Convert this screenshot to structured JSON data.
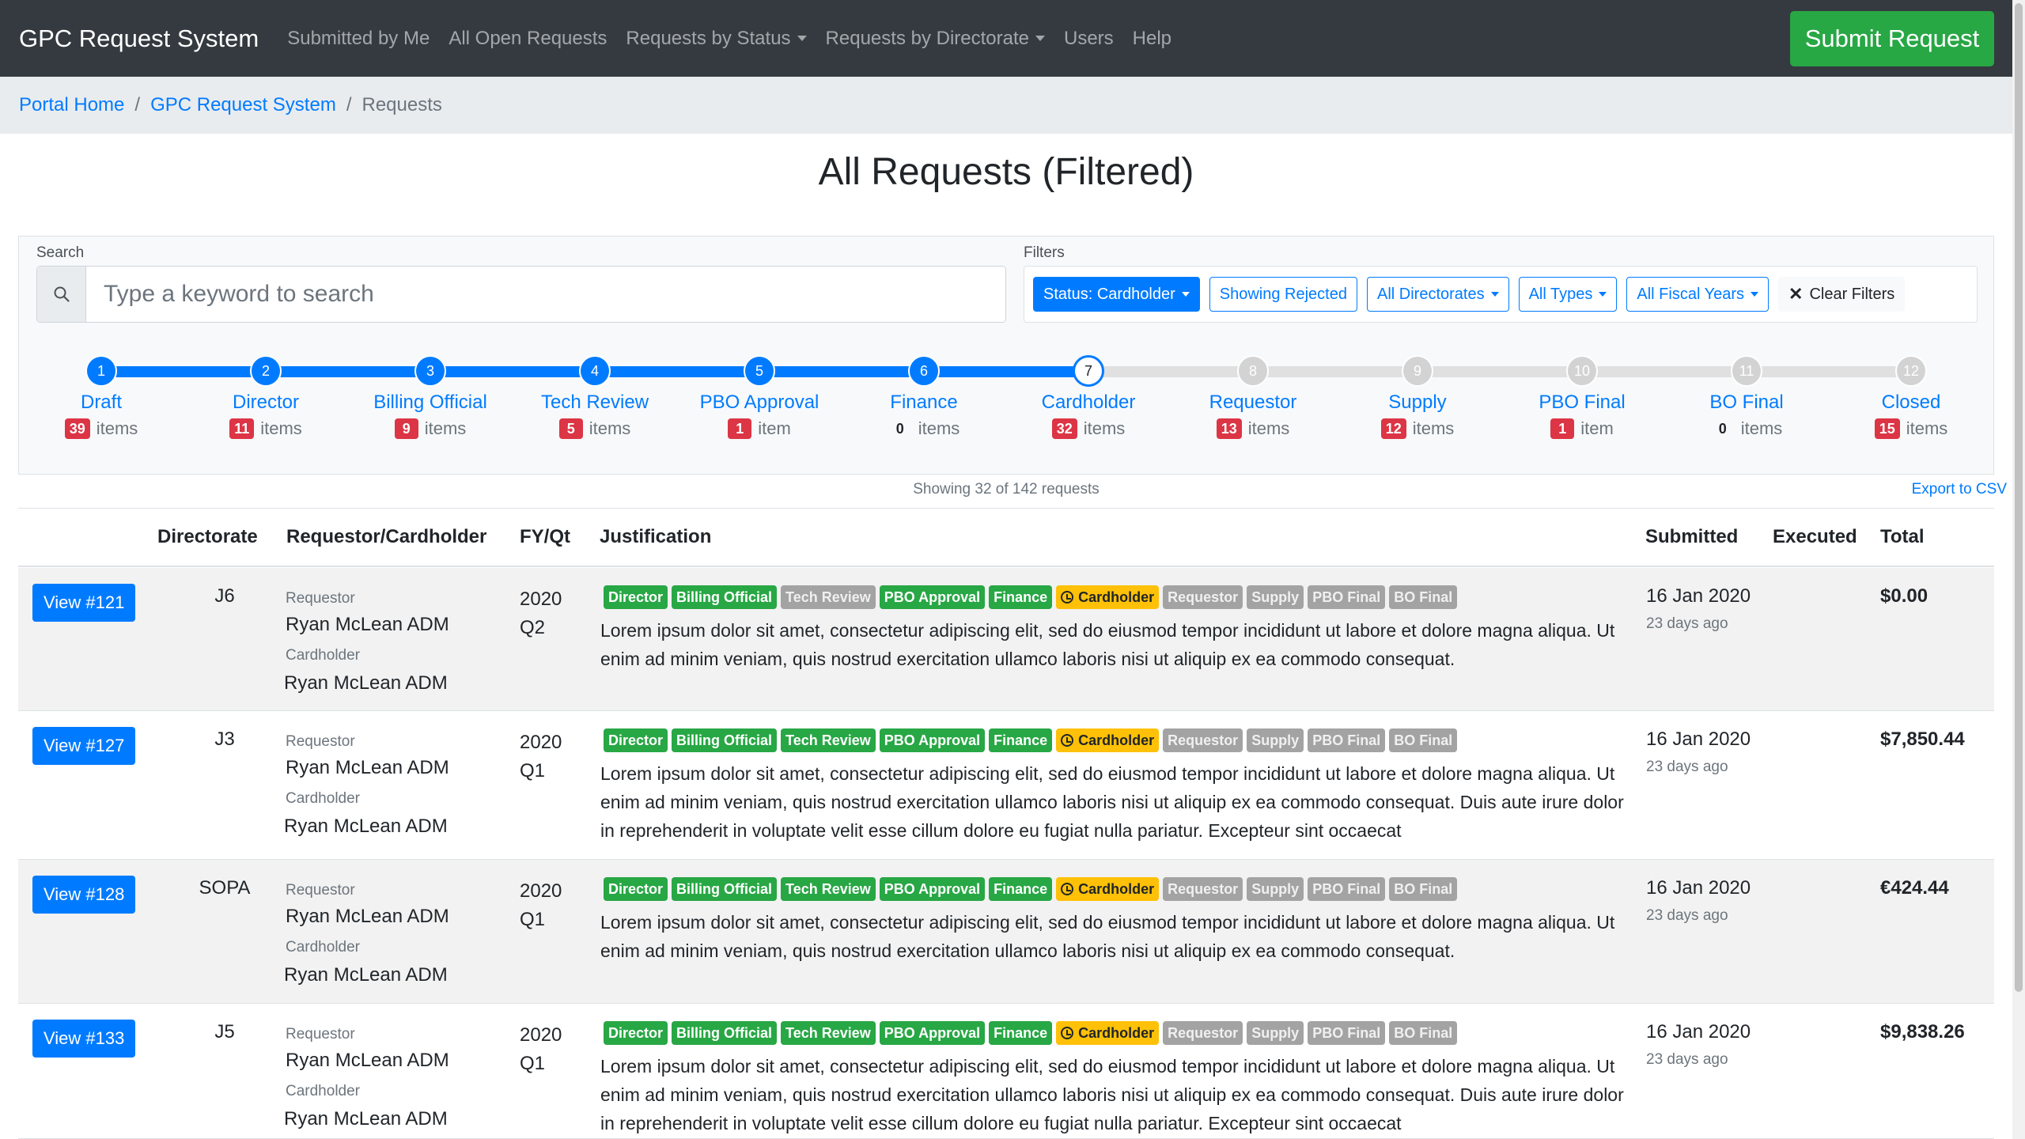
{
  "nav": {
    "brand": "GPC Request System",
    "links": [
      {
        "label": "Submitted by Me"
      },
      {
        "label": "All Open Requests"
      },
      {
        "label": "Requests by Status"
      },
      {
        "label": "Requests by Directorate"
      },
      {
        "label": "Users"
      },
      {
        "label": "Help"
      }
    ],
    "submit_label": "Submit Request"
  },
  "breadcrumb": {
    "items": [
      "Portal Home",
      "GPC Request System"
    ],
    "active": "Requests"
  },
  "page": {
    "title": "All Requests (Filtered)"
  },
  "search": {
    "label": "Search",
    "placeholder": "Type a keyword to search"
  },
  "filters": {
    "label": "Filters",
    "status": "Status: Cardholder",
    "rejected": "Showing Rejected",
    "directorates": "All Directorates",
    "types": "All Types",
    "fiscal_years": "All Fiscal Years",
    "clear": "Clear Filters"
  },
  "stepper": {
    "steps": [
      {
        "n": "1",
        "label": "Draft",
        "count": "39",
        "unit": "items",
        "state": "done"
      },
      {
        "n": "2",
        "label": "Director",
        "count": "11",
        "unit": "items",
        "state": "done"
      },
      {
        "n": "3",
        "label": "Billing Official",
        "count": "9",
        "unit": "items",
        "state": "done"
      },
      {
        "n": "4",
        "label": "Tech Review",
        "count": "5",
        "unit": "items",
        "state": "done"
      },
      {
        "n": "5",
        "label": "PBO Approval",
        "count": "1",
        "unit": "item",
        "state": "done"
      },
      {
        "n": "6",
        "label": "Finance",
        "count": "0",
        "unit": "items",
        "state": "done"
      },
      {
        "n": "7",
        "label": "Cardholder",
        "count": "32",
        "unit": "items",
        "state": "current"
      },
      {
        "n": "8",
        "label": "Requestor",
        "count": "13",
        "unit": "items",
        "state": "pending"
      },
      {
        "n": "9",
        "label": "Supply",
        "count": "12",
        "unit": "items",
        "state": "pending"
      },
      {
        "n": "10",
        "label": "PBO Final",
        "count": "1",
        "unit": "item",
        "state": "pending"
      },
      {
        "n": "11",
        "label": "BO Final",
        "count": "0",
        "unit": "items",
        "state": "pending"
      },
      {
        "n": "12",
        "label": "Closed",
        "count": "15",
        "unit": "items",
        "state": "pending"
      }
    ]
  },
  "table": {
    "showing": "Showing 32 of 142 requests",
    "export": "Export to CSV",
    "headers": {
      "directorate": "Directorate",
      "requestor": "Requestor/Cardholder",
      "fyqt": "FY/Qt",
      "justification": "Justification",
      "submitted": "Submitted",
      "executed": "Executed",
      "total": "Total"
    },
    "labels": {
      "requestor": "Requestor",
      "cardholder": "Cardholder"
    },
    "badge_labels": [
      "Director",
      "Billing Official",
      "Tech Review",
      "PBO Approval",
      "Finance",
      "Cardholder",
      "Requestor",
      "Supply",
      "PBO Final",
      "BO Final"
    ],
    "rows": [
      {
        "view": "View #121",
        "directorate": "J6",
        "requestor": "Ryan McLean ADM",
        "cardholder": "Ryan McLean ADM",
        "fy": "2020",
        "qt": "Q2",
        "badge_states": [
          "green",
          "green",
          "grey",
          "green",
          "green",
          "yellow",
          "grey",
          "grey",
          "grey",
          "grey"
        ],
        "justification": "Lorem ipsum dolor sit amet, consectetur adipiscing elit, sed do eiusmod tempor incididunt ut labore et dolore magna aliqua. Ut enim ad minim veniam, quis nostrud exercitation ullamco laboris nisi ut aliquip ex ea commodo consequat.",
        "submitted": "16 Jan 2020",
        "ago": "23 days ago",
        "executed": "",
        "total": "$0.00"
      },
      {
        "view": "View #127",
        "directorate": "J3",
        "requestor": "Ryan McLean ADM",
        "cardholder": "Ryan McLean ADM",
        "fy": "2020",
        "qt": "Q1",
        "badge_states": [
          "green",
          "green",
          "green",
          "green",
          "green",
          "yellow",
          "grey",
          "grey",
          "grey",
          "grey"
        ],
        "justification": "Lorem ipsum dolor sit amet, consectetur adipiscing elit, sed do eiusmod tempor incididunt ut labore et dolore magna aliqua. Ut enim ad minim veniam, quis nostrud exercitation ullamco laboris nisi ut aliquip ex ea commodo consequat. Duis aute irure dolor in reprehenderit in voluptate velit esse cillum dolore eu fugiat nulla pariatur. Excepteur sint occaecat",
        "submitted": "16 Jan 2020",
        "ago": "23 days ago",
        "executed": "",
        "total": "$7,850.44"
      },
      {
        "view": "View #128",
        "directorate": "SOPA",
        "requestor": "Ryan McLean ADM",
        "cardholder": "Ryan McLean ADM",
        "fy": "2020",
        "qt": "Q1",
        "badge_states": [
          "green",
          "green",
          "green",
          "green",
          "green",
          "yellow",
          "grey",
          "grey",
          "grey",
          "grey"
        ],
        "justification": "Lorem ipsum dolor sit amet, consectetur adipiscing elit, sed do eiusmod tempor incididunt ut labore et dolore magna aliqua. Ut enim ad minim veniam, quis nostrud exercitation ullamco laboris nisi ut aliquip ex ea commodo consequat.",
        "submitted": "16 Jan 2020",
        "ago": "23 days ago",
        "executed": "",
        "total": "€424.44"
      },
      {
        "view": "View #133",
        "directorate": "J5",
        "requestor": "Ryan McLean ADM",
        "cardholder": "Ryan McLean ADM",
        "fy": "2020",
        "qt": "Q1",
        "badge_states": [
          "green",
          "green",
          "green",
          "green",
          "green",
          "yellow",
          "grey",
          "grey",
          "grey",
          "grey"
        ],
        "justification": "Lorem ipsum dolor sit amet, consectetur adipiscing elit, sed do eiusmod tempor incididunt ut labore et dolore magna aliqua. Ut enim ad minim veniam, quis nostrud exercitation ullamco laboris nisi ut aliquip ex ea commodo consequat. Duis aute irure dolor in reprehenderit in voluptate velit esse cillum dolore eu fugiat nulla pariatur. Excepteur sint occaecat",
        "submitted": "16 Jan 2020",
        "ago": "23 days ago",
        "executed": "",
        "total": "$9,838.26"
      }
    ]
  },
  "colors": {
    "navbar": "#343a40",
    "primary": "#007bff",
    "success": "#28a745",
    "danger": "#dc3545",
    "warning": "#ffc107",
    "muted": "#6c757d"
  },
  "icons": {
    "search": "search-icon",
    "clear": "close-icon",
    "clock": "clock-icon",
    "caret": "chevron-down-icon"
  }
}
